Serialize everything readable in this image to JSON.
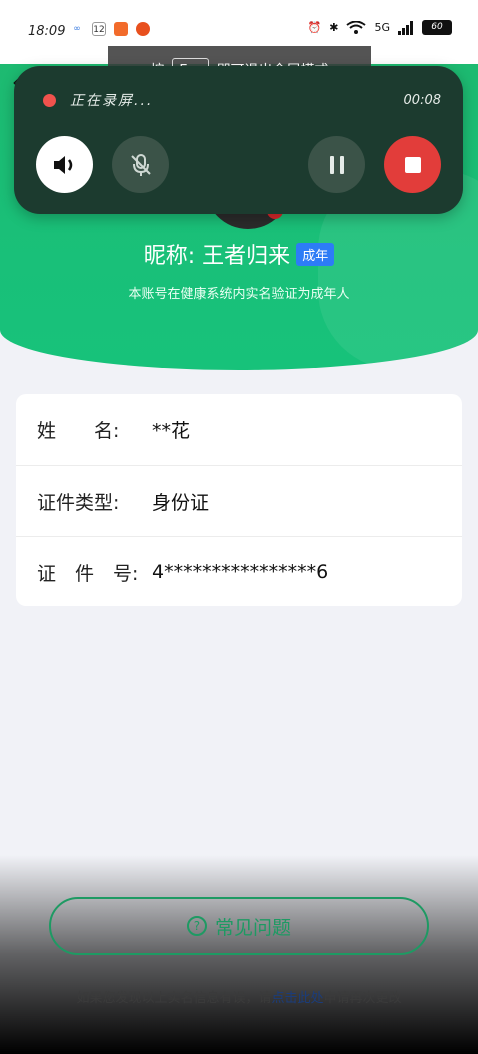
{
  "status_bar": {
    "time": "18:09",
    "small_icons": [
      "baidu-netdisk-icon",
      "calendar-icon",
      "game-icon",
      "app-icon"
    ],
    "calendar_day": "12",
    "network": "5G",
    "battery": "60"
  },
  "fullscreen_hint": {
    "prefix": "按",
    "key": "Esc",
    "suffix": "即可退出全屏模式"
  },
  "recorder": {
    "status_label": "正在录屏...",
    "timer": "00:08",
    "colors": {
      "panel": "#1c3b2f",
      "stop": "#e23d3a",
      "dot": "#f1524d"
    }
  },
  "profile": {
    "nickname": "昵称: 王者归来",
    "badge": "成年",
    "subtitle": "本账号在健康系统内实名验证为成年人"
  },
  "info": {
    "rows": [
      {
        "key": "姓　　名:",
        "value": "**花"
      },
      {
        "key": "证件类型:",
        "value": "身份证"
      },
      {
        "key": "证　件　号:",
        "value": "4****************6"
      }
    ]
  },
  "faq_button": {
    "label": "常见问题"
  },
  "footnote": {
    "before": "如果您发现以上实名信息有误，请",
    "link": "点击此处",
    "after": "申请再次更改"
  },
  "colors": {
    "brand_green": "#19c079",
    "badge_blue": "#2d7cf6"
  }
}
